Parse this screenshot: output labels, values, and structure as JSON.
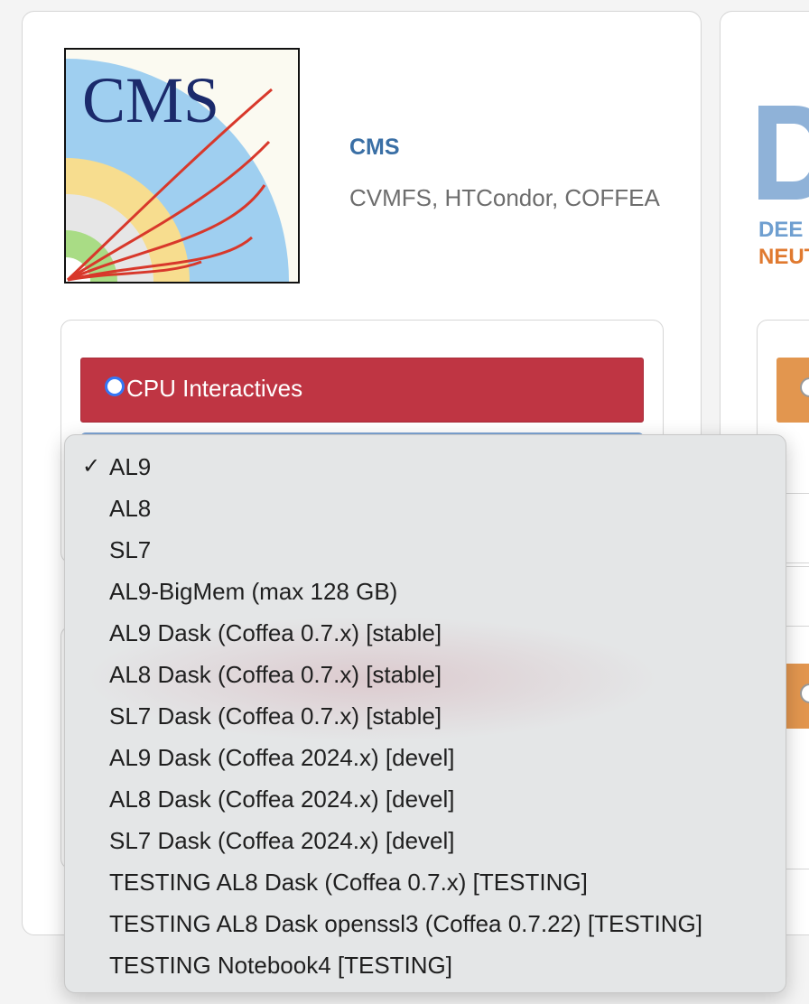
{
  "card": {
    "experiment_name": "CMS",
    "description": "CVMFS, HTCondor, COFFEA",
    "logo_text": "CMS"
  },
  "profile": {
    "label": "CPU Interactives",
    "accent_color": "#bf3543"
  },
  "right_card": {
    "text_line_1": "DEE",
    "text_line_2": "NEUT",
    "accent_color": "#e2964f"
  },
  "dropdown": {
    "selected": "AL9",
    "check_mark": "✓",
    "options": [
      "AL9",
      "AL8",
      "SL7",
      "AL9-BigMem (max 128 GB)",
      "AL9 Dask (Coffea 0.7.x) [stable]",
      "AL8 Dask (Coffea 0.7.x) [stable]",
      "SL7 Dask (Coffea 0.7.x) [stable]",
      "AL9 Dask (Coffea 2024.x) [devel]",
      "AL8 Dask (Coffea 2024.x) [devel]",
      "SL7 Dask (Coffea 2024.x) [devel]",
      "TESTING AL8 Dask (Coffea 0.7.x) [TESTING]",
      "TESTING AL8 Dask openssl3 (Coffea 0.7.22) [TESTING]",
      "TESTING Notebook4 [TESTING]"
    ]
  }
}
